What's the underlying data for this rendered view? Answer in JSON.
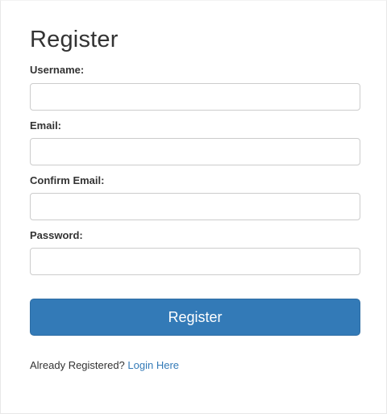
{
  "form": {
    "title": "Register",
    "fields": [
      {
        "label": "Username:",
        "value": "",
        "placeholder": ""
      },
      {
        "label": "Email:",
        "value": "",
        "placeholder": ""
      },
      {
        "label": "Confirm Email:",
        "value": "",
        "placeholder": ""
      },
      {
        "label": "Password:",
        "value": "",
        "placeholder": ""
      }
    ],
    "submit_label": "Register"
  },
  "footer": {
    "prompt_text": "Already Registered?",
    "login_link_label": "Login Here"
  },
  "colors": {
    "primary": "#337ab7",
    "text": "#333333",
    "input_border": "#cccccc"
  }
}
